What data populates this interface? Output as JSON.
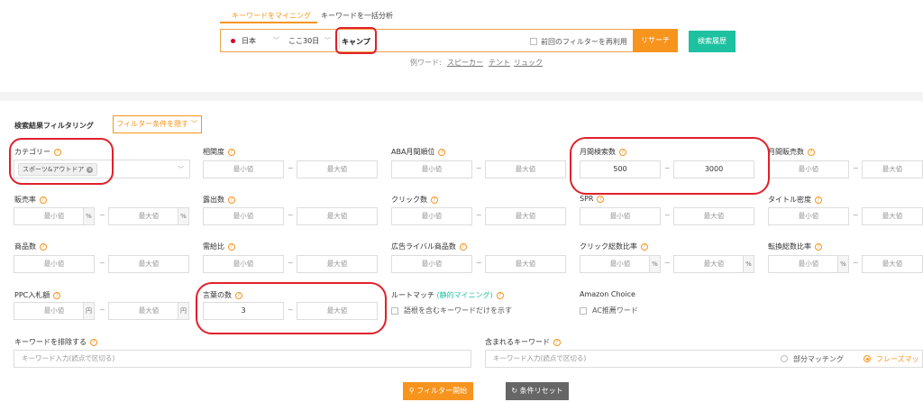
{
  "tabs": {
    "active": "キーワードをマイニング",
    "second": "キーワードを一括分析"
  },
  "search": {
    "country": "日本",
    "period": "ここ30日",
    "keyword": "キャンプ",
    "reuse_label": "前回のフィルターを再利用",
    "research_button": "リサーチ",
    "history_button": "検索履歴",
    "examples_prefix": "例ワード:",
    "examples": [
      "スピーカー",
      "テント",
      "リュック"
    ]
  },
  "filter": {
    "title": "検索結果フィルタリング",
    "hide_button": "フィルター条件を隠す",
    "min_placeholder": "最小値",
    "max_placeholder": "最大値",
    "dash": "~",
    "percent": "%",
    "yen": "円",
    "category": {
      "label": "カテゴリー",
      "tag": "スポーツ&アウトドア"
    },
    "labels": {
      "correlation": "相関度",
      "aba_rank": "ABA月間順位",
      "monthly_search": "月間検索数",
      "monthly_sales": "月間販売数",
      "sales_rate": "販売率",
      "impressions": "露出数",
      "clicks": "クリック数",
      "spr": "SPR",
      "title_density": "タイトル密度",
      "product_count": "商品数",
      "supply_demand": "需給比",
      "ad_competitors": "広告ライバル商品数",
      "click_share": "クリック総数比率",
      "conversion_share": "転換総数比率",
      "ppc_bid": "PPC入札額",
      "word_count": "言葉の数",
      "root_match": "ルートマッチ",
      "root_match_note": "(静的マイニング)",
      "amazon_choice": "Amazon Choice"
    },
    "values": {
      "monthly_search_min": "500",
      "monthly_search_max": "3000",
      "word_count_min": "3"
    },
    "root_checkbox_label": "語根を含むキーワードだけを示す",
    "ac_checkbox_label": "AC推薦ワード",
    "exclude_label": "キーワードを排除する",
    "include_label": "含まれるキーワード",
    "kw_input_placeholder": "キーワード入力(読点で区切る)",
    "partial_match": "部分マッチング",
    "phrase_match": "フレーズマッ",
    "apply_button": "フィルター開始",
    "reset_button": "条件リセット"
  },
  "colors": {
    "accent": "#f7941d",
    "teal": "#1dc1a0",
    "annotation": "#e0212b"
  }
}
